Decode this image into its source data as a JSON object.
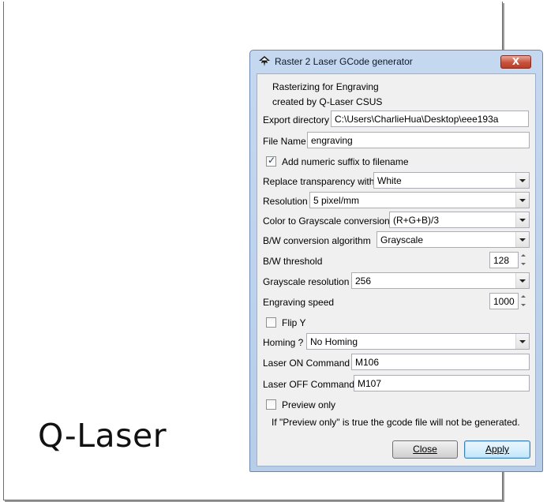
{
  "canvas": {
    "text": "Q-Laser"
  },
  "dialog": {
    "title": "Raster 2 Laser GCode generator",
    "close_label": "X",
    "intro_line1": "Rasterizing for Engraving",
    "intro_line2": "created by Q-Laser CSUS",
    "export_dir": {
      "label": "Export directory",
      "value": "C:\\Users\\CharlieHua\\Desktop\\eee193a"
    },
    "file_name": {
      "label": "File Name",
      "value": "engraving"
    },
    "numeric_suffix": {
      "label": "Add numeric suffix to filename",
      "checked": true
    },
    "transparency": {
      "label": "Replace transparency with",
      "value": "White"
    },
    "resolution": {
      "label": "Resolution",
      "value": "5 pixel/mm"
    },
    "grayscale_conv": {
      "label": "Color to Grayscale conversion",
      "value": "(R+G+B)/3"
    },
    "bw_algorithm": {
      "label": "B/W conversion algorithm",
      "value": "Grayscale"
    },
    "bw_threshold": {
      "label": "B/W threshold",
      "value": "128"
    },
    "grayscale_res": {
      "label": "Grayscale resolution",
      "value": "256"
    },
    "engraving_speed": {
      "label": "Engraving speed",
      "value": "1000"
    },
    "flip_y": {
      "label": "Flip Y",
      "checked": false
    },
    "homing": {
      "label": "Homing ?",
      "value": "No Homing"
    },
    "laser_on": {
      "label": "Laser ON Command",
      "value": "M106"
    },
    "laser_off": {
      "label": "Laser OFF Command",
      "value": "M107"
    },
    "preview_only": {
      "label": "Preview only",
      "checked": false
    },
    "preview_note": "If \"Preview only\" is true the gcode file will not be generated.",
    "close_button": "Close",
    "apply_button": "Apply"
  }
}
